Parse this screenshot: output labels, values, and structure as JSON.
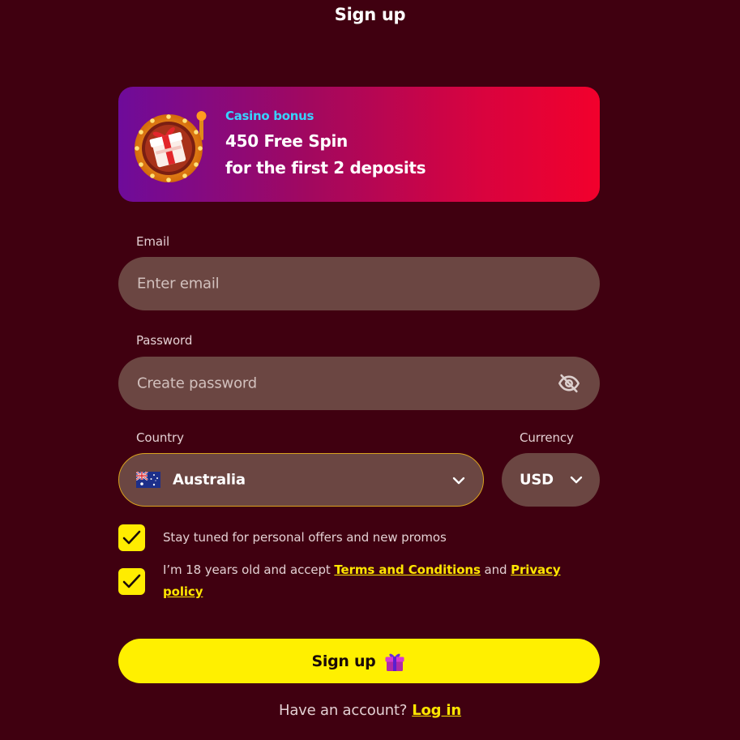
{
  "header": {
    "title": "Sign up"
  },
  "bonus": {
    "tag": "Casino bonus",
    "line1": "450 Free Spin",
    "line2": "for the first 2 deposits",
    "illustration_icon": "slot-wheel-gift-icon"
  },
  "form": {
    "email": {
      "label": "Email",
      "placeholder": "Enter email"
    },
    "password": {
      "label": "Password",
      "placeholder": "Create password",
      "toggle_icon": "eye-slash-icon"
    },
    "country": {
      "label": "Country",
      "value": "Australia",
      "flag_icon": "australia-flag-icon"
    },
    "currency": {
      "label": "Currency",
      "value": "USD"
    },
    "checkboxes": [
      {
        "checked": true,
        "text": "Stay tuned for personal offers and new promos"
      },
      {
        "checked": true,
        "text_before": "I’m 18 years old and accept ",
        "link1": "Terms and Conditions",
        "text_middle": " and ",
        "link2": "Privacy policy"
      }
    ],
    "submit": {
      "label": "Sign up",
      "icon": "gift-icon"
    }
  },
  "footer": {
    "question": "Have an account?",
    "login_link": "Log in"
  },
  "colors": {
    "background": "#400010",
    "accent_yellow": "#fff000",
    "link_yellow": "#ffe600",
    "input_bg": "#6b4642",
    "bonus_tag": "#38d3ff",
    "bonus_gradient_start": "#6e0b9a",
    "bonus_gradient_end": "#f2002c",
    "country_border": "#d9a21e"
  }
}
